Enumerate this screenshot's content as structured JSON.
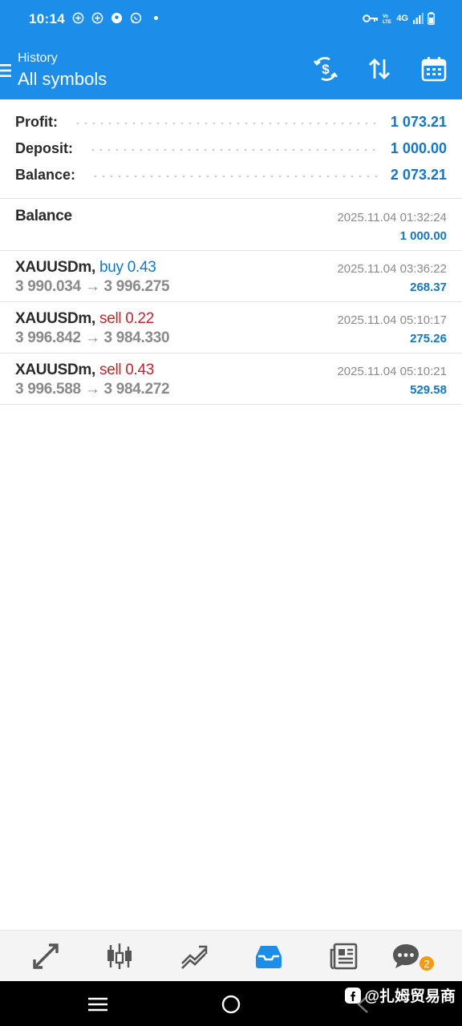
{
  "status_bar": {
    "time": "10:14",
    "network": "4G",
    "left_icons": [
      "notification-plus-icon",
      "notification-plus-icon",
      "location-pin-icon",
      "whatsapp-icon"
    ],
    "right_icons": [
      "key-icon",
      "signal-icon",
      "battery-icon"
    ]
  },
  "header": {
    "subtitle": "History",
    "title": "All symbols",
    "actions": [
      "money-transfer-icon",
      "sort-icon",
      "calendar-icon"
    ]
  },
  "summary": {
    "profit_label": "Profit:",
    "profit_value": "1 073.21",
    "deposit_label": "Deposit:",
    "deposit_value": "1 000.00",
    "balance_label": "Balance:",
    "balance_value": "2 073.21"
  },
  "deals": [
    {
      "title": "Balance",
      "time": "2025.11.04 01:32:24",
      "amount": "1 000.00"
    },
    {
      "symbol": "XAUUSDm,",
      "side": "buy 0.43",
      "open_price": "3 990.034",
      "arrow": "→",
      "close_price": "3 996.275",
      "time": "2025.11.04 03:36:22",
      "amount": "268.37"
    },
    {
      "symbol": "XAUUSDm,",
      "side": "sell 0.22",
      "open_price": "3 996.842",
      "arrow": "→",
      "close_price": "3 984.330",
      "time": "2025.11.04 05:10:17",
      "amount": "275.26"
    },
    {
      "symbol": "XAUUSDm,",
      "side": "sell 0.43",
      "open_price": "3 996.588",
      "arrow": "→",
      "close_price": "3 984.272",
      "time": "2025.11.04 05:10:21",
      "amount": "529.58"
    }
  ],
  "tabbar": {
    "tabs": [
      "quotes-icon",
      "chart-icon",
      "trade-icon",
      "history-icon",
      "news-icon",
      "chat-icon"
    ],
    "active": "history-icon",
    "chat_badge": "2"
  },
  "watermark": "@扎姆贸易商",
  "colors": {
    "primary": "#1c8eea",
    "value_blue": "#1476c4",
    "sell_red": "#c8232c",
    "badge_orange": "#f39c12"
  }
}
